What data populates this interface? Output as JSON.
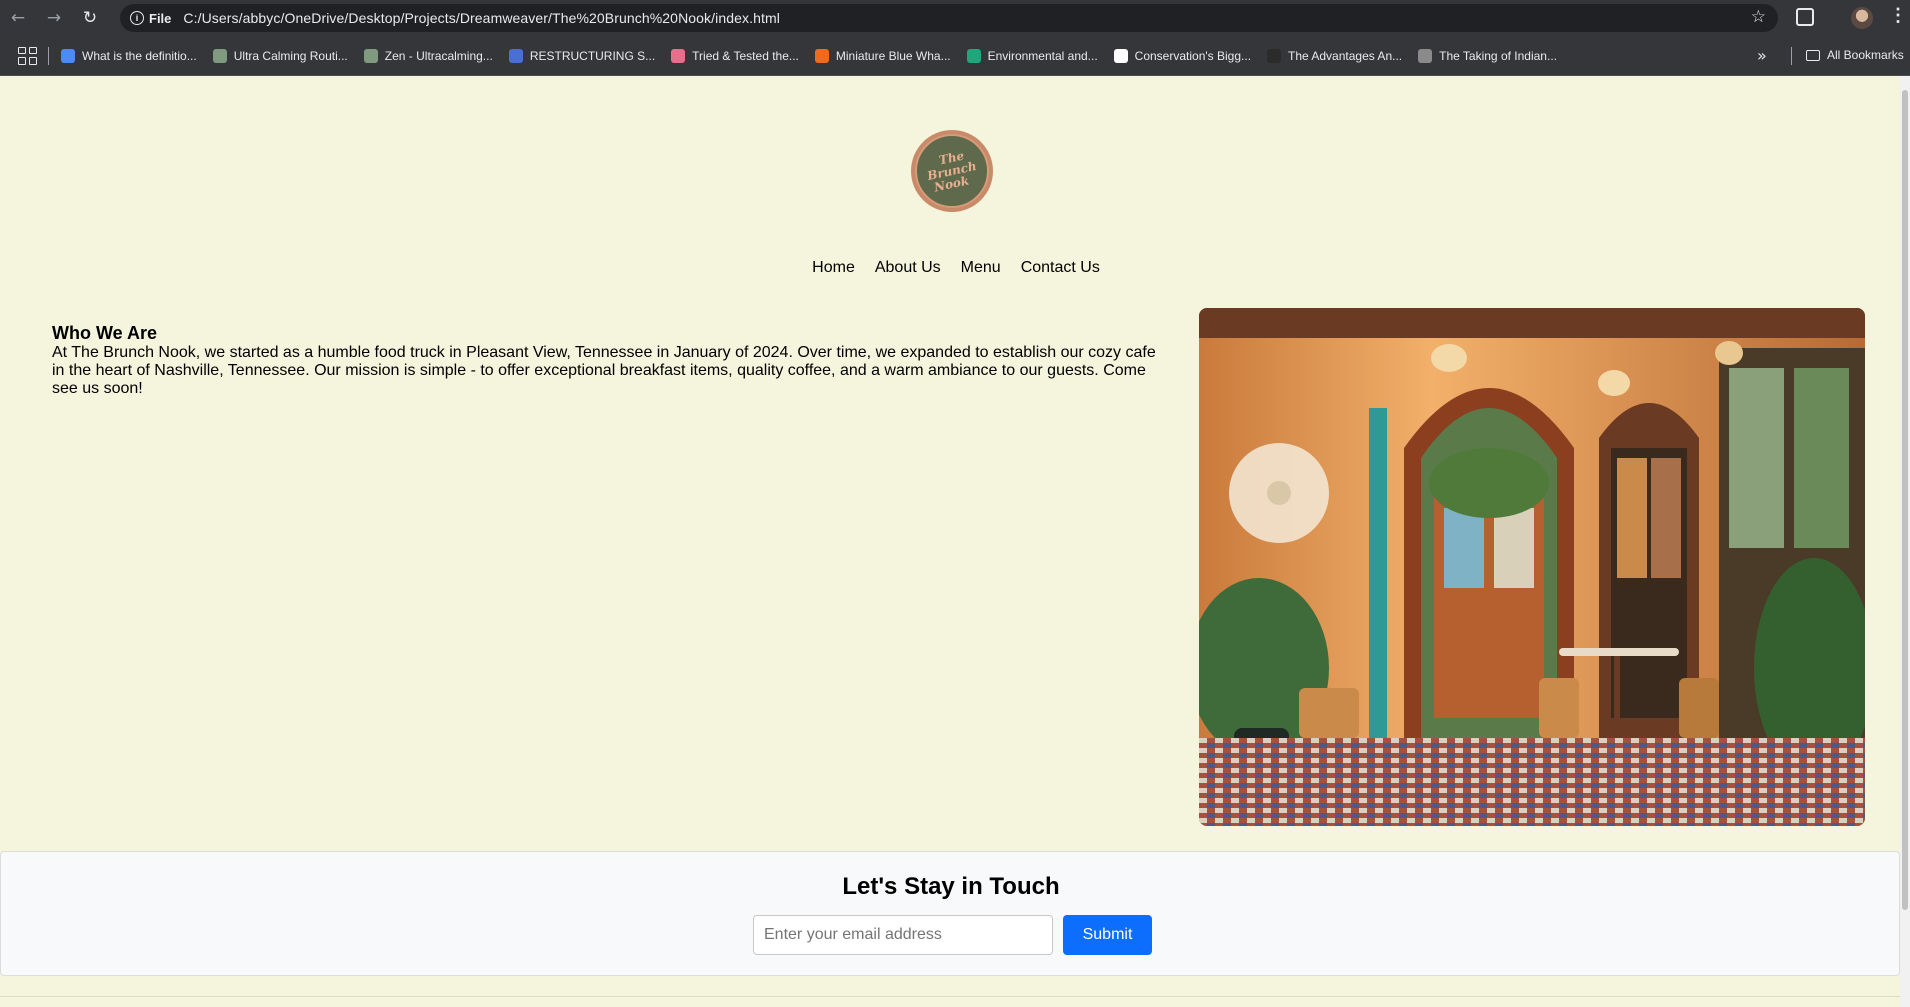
{
  "browser": {
    "address_chip": "File",
    "url": "C:/Users/abbyc/OneDrive/Desktop/Projects/Dreamweaver/The%20Brunch%20Nook/index.html",
    "back_icon": "←",
    "forward_icon": "→",
    "reload_icon": "↻",
    "star_icon": "☆",
    "kebab_icon": "⋮",
    "more_bookmarks_icon": "»"
  },
  "bookmarks": [
    {
      "label": "What is the definitio...",
      "color": "#4c8bf5"
    },
    {
      "label": "Ultra Calming Routi...",
      "color": "#7f9a7f"
    },
    {
      "label": "Zen - Ultracalming...",
      "color": "#7f9a7f"
    },
    {
      "label": "RESTRUCTURING S...",
      "color": "#4a6fd4"
    },
    {
      "label": "Tried & Tested the...",
      "color": "#e86f8c"
    },
    {
      "label": "Miniature Blue Wha...",
      "color": "#f06a1d"
    },
    {
      "label": "Environmental and...",
      "color": "#1fa67a"
    },
    {
      "label": "Conservation's Bigg...",
      "color": "#ffffff"
    },
    {
      "label": "The Advantages An...",
      "color": "#2b2b2b"
    },
    {
      "label": "The Taking of Indian...",
      "color": "#8a8a8a"
    }
  ],
  "all_bookmarks_label": "All Bookmarks",
  "site": {
    "logo_lines": [
      "The",
      "Brunch",
      "Nook"
    ],
    "nav": {
      "home": "Home",
      "about": "About Us",
      "menu": "Menu",
      "contact": "Contact Us"
    },
    "about": {
      "title": "Who We Are",
      "text": "At The Brunch Nook, we started as a humble food truck in Pleasant View, Tennessee in January of 2024. Over time, we expanded to establish our cozy cafe in the heart of Nashville, Tennessee. Our mission is simple - to offer exceptional breakfast items, quality coffee, and a warm ambiance to our guests. Come see us soon!"
    },
    "newsletter": {
      "title": "Let's Stay in Touch",
      "placeholder": "Enter your email address",
      "value": "",
      "submit": "Submit"
    }
  }
}
